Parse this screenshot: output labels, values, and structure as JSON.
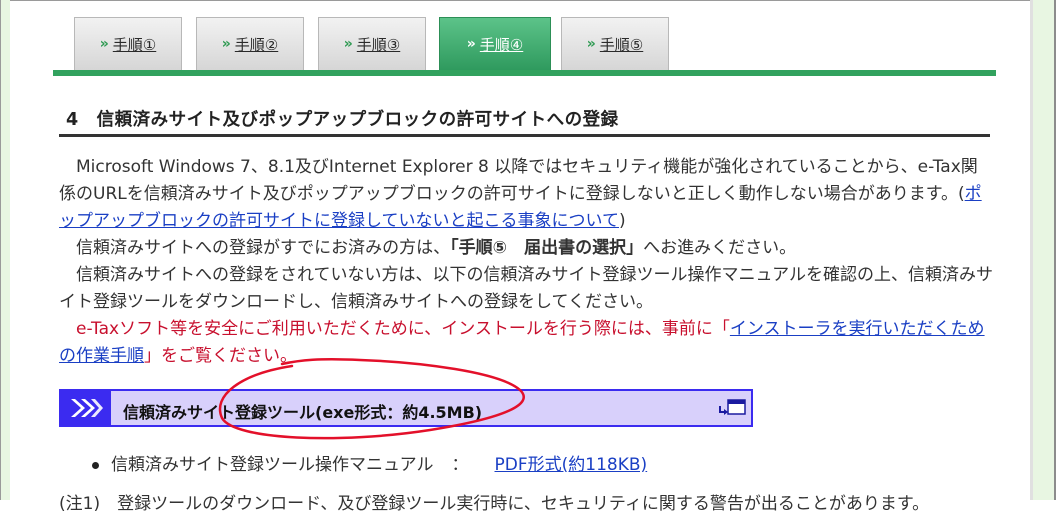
{
  "tabs": [
    {
      "label": "手順①",
      "active": false
    },
    {
      "label": "手順②",
      "active": false
    },
    {
      "label": "手順③",
      "active": false
    },
    {
      "label": "手順④",
      "active": true
    },
    {
      "label": "手順⑤",
      "active": false
    }
  ],
  "tab_chevron": "»",
  "section": {
    "heading": "4　信頼済みサイト及びポップアップブロックの許可サイトへの登録"
  },
  "paragraphs": {
    "p1_text": "Microsoft Windows 7、8.1及びInternet Explorer 8 以降ではセキュリティ機能が強化されていることから、e-Tax関係のURLを信頼済みサイト及びポップアップブロックの許可サイトに登録しないと正しく動作しない場合があります。(",
    "p1_link": "ポップアップブロックの許可サイトに登録していないと起こる事象について",
    "p1_end": ")",
    "p2_pre": "信頼済みサイトへの登録がすでにお済みの方は、",
    "p2_bold": "「手順⑤　届出書の選択」",
    "p2_post": "へお進みください。",
    "p3_text": "信頼済みサイトへの登録をされていない方は、以下の信頼済みサイト登録ツール操作マニュアルを確認の上、信頼済みサイト登録ツールをダウンロードし、信頼済みサイトへの登録をしてください。",
    "p4_pre": "e-Taxソフト等を安全にご利用いただくために、インストールを行う際には、事前に「",
    "p4_link": "インストーラを実行いただくための作業手順",
    "p4_post": "」をご覧ください。"
  },
  "download": {
    "label": "信頼済みサイト登録ツール(exe形式：約4.5MB)",
    "chevron_icon": "double-chevron-right-icon",
    "window_icon": "new-window-icon",
    "accent_color": "#3b2bf0",
    "bg_color": "#d8d0fb"
  },
  "manual": {
    "label": "信頼済みサイト登録ツール操作マニュアル",
    "separator": "：",
    "link": "PDF形式(約118KB)"
  },
  "footnote": "(注1)　登録ツールのダウンロード、及び登録ツール実行時に、セキュリティに関する警告が出ることがあります。",
  "colors": {
    "tab_active": "#32a25e",
    "annotation": "#e3102a",
    "link": "#1a3fc4",
    "warning": "#c8102e"
  }
}
